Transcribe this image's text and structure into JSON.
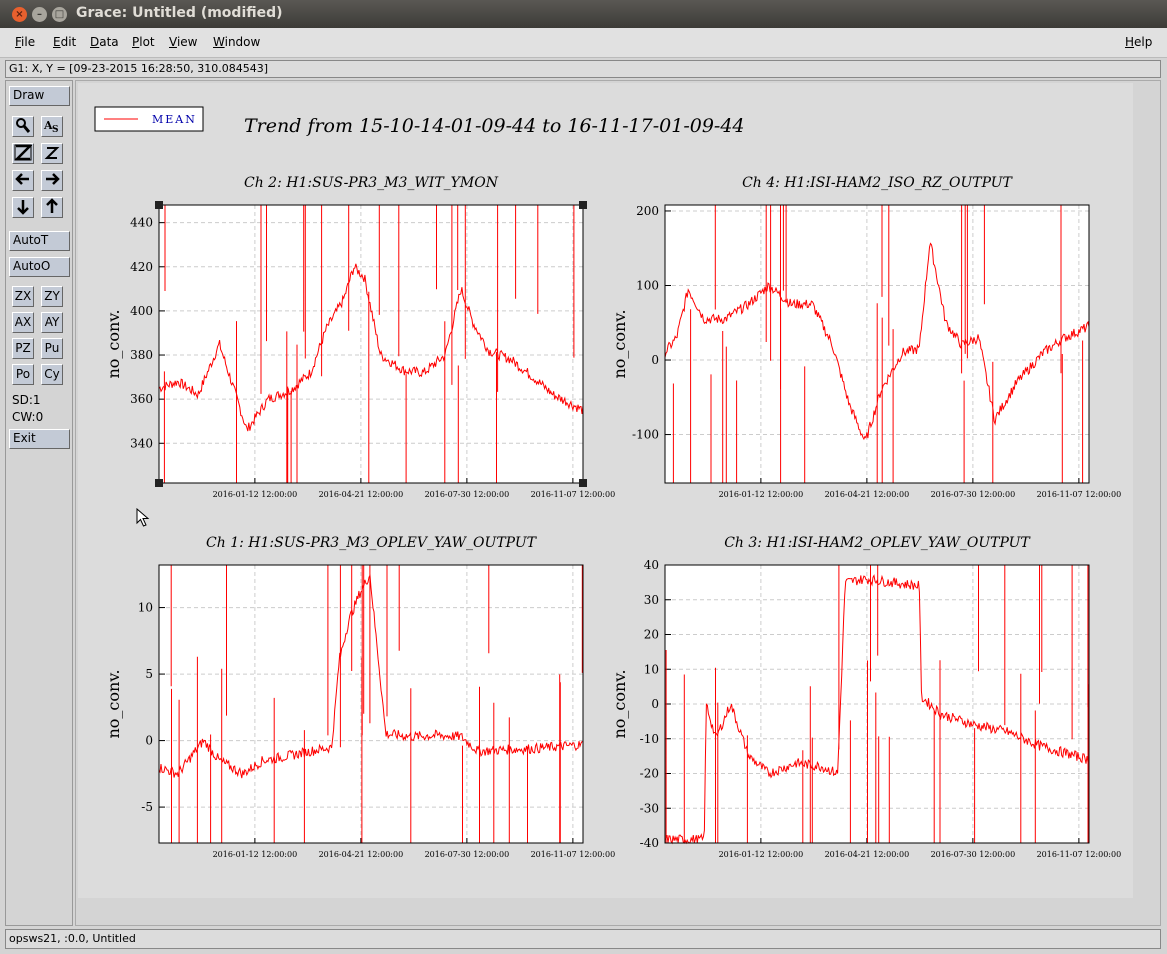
{
  "window": {
    "title": "Grace: Untitled (modified)",
    "close_glyph": "×",
    "min_glyph": "–",
    "max_glyph": "□"
  },
  "menu": {
    "file": "File",
    "edit": "Edit",
    "data": "Data",
    "plot": "Plot",
    "view": "View",
    "window": "Window",
    "help": "Help"
  },
  "locator": "G1: X, Y = [09-23-2015 16:28:50, 310.084543]",
  "toolbar": {
    "draw": "Draw",
    "autot": "AutoT",
    "autoo": "AutoO",
    "exit": "Exit",
    "zx": "ZX",
    "zy": "ZY",
    "ax": "AX",
    "ay": "AY",
    "pz": "PZ",
    "pu": "Pu",
    "po": "Po",
    "cy": "Cy",
    "sd": "SD:1",
    "cw": "CW:0",
    "icons": [
      "zoom-icon",
      "text-icon",
      "autoscale-z-icon",
      "zoom-out-icon",
      "left-arrow-icon",
      "right-arrow-icon",
      "down-arrow-icon",
      "up-arrow-icon"
    ]
  },
  "status": "opsws21, :0.0, Untitled",
  "legend": {
    "label": "MEAN"
  },
  "figure_title": "Trend from 15-10-14-01-09-44 to 16-11-17-01-09-44",
  "colors": {
    "series": "#ff0000",
    "plot_bg": "#ffffff",
    "canvas_bg": "#dcdcdc"
  },
  "chart_data": [
    {
      "type": "line",
      "title": "Ch 2: H1:SUS-PR3_M3_WIT_YMON",
      "ylabel": "no_conv.",
      "xlabel": "",
      "x_ticks": [
        "2016-01-12 12:00:00",
        "2016-04-21 12:00:00",
        "2016-07-30 12:00:00",
        "2016-11-07 12:00:00"
      ],
      "y_ticks": [
        "340",
        "360",
        "380",
        "400",
        "420",
        "440"
      ],
      "ylim": [
        322,
        448
      ],
      "series": [
        {
          "name": "MEAN",
          "x": [
            "2015-10-14",
            "2015-11-01",
            "2015-11-20",
            "2015-12-10",
            "2016-01-05",
            "2016-01-25",
            "2016-02-15",
            "2016-03-05",
            "2016-03-20",
            "2016-04-05",
            "2016-04-15",
            "2016-04-25",
            "2016-05-10",
            "2016-06-01",
            "2016-06-20",
            "2016-07-10",
            "2016-07-25",
            "2016-08-05",
            "2016-08-20",
            "2016-09-10",
            "2016-10-01",
            "2016-10-20",
            "2016-11-17"
          ],
          "values": [
            365,
            368,
            362,
            385,
            346,
            360,
            364,
            372,
            392,
            405,
            420,
            415,
            380,
            373,
            372,
            380,
            410,
            395,
            382,
            378,
            370,
            362,
            355
          ]
        }
      ]
    },
    {
      "type": "line",
      "title": "Ch 4: H1:ISI-HAM2_ISO_RZ_OUTPUT",
      "ylabel": "no_conv.",
      "xlabel": "",
      "x_ticks": [
        "2016-01-12 12:00:00",
        "2016-04-21 12:00:00",
        "2016-07-30 12:00:00",
        "2016-11-07 12:00:00"
      ],
      "y_ticks": [
        "-100",
        "0",
        "100",
        "200"
      ],
      "ylim": [
        -165,
        208
      ],
      "series": [
        {
          "name": "MEAN",
          "x": [
            "2015-10-14",
            "2015-10-25",
            "2015-11-05",
            "2015-11-20",
            "2015-12-10",
            "2016-01-01",
            "2016-01-20",
            "2016-02-10",
            "2016-03-01",
            "2016-03-20",
            "2016-04-05",
            "2016-04-20",
            "2016-05-05",
            "2016-05-25",
            "2016-06-10",
            "2016-06-20",
            "2016-07-05",
            "2016-07-20",
            "2016-08-05",
            "2016-08-20",
            "2016-09-10",
            "2016-10-05",
            "2016-10-25",
            "2016-11-17"
          ],
          "values": [
            10,
            30,
            95,
            55,
            55,
            75,
            100,
            75,
            75,
            20,
            -60,
            -110,
            -40,
            10,
            15,
            160,
            50,
            20,
            30,
            -80,
            -30,
            10,
            30,
            45
          ]
        }
      ]
    },
    {
      "type": "line",
      "title": "Ch 1: H1:SUS-PR3_M3_OPLEV_YAW_OUTPUT",
      "ylabel": "no_conv.",
      "xlabel": "",
      "x_ticks": [
        "2016-01-12 12:00:00",
        "2016-04-21 12:00:00",
        "2016-07-30 12:00:00",
        "2016-11-07 12:00:00"
      ],
      "y_ticks": [
        "-5",
        "0",
        "5",
        "10"
      ],
      "ylim": [
        -7.7,
        13.2
      ],
      "series": [
        {
          "name": "MEAN",
          "x": [
            "2015-10-14",
            "2015-11-01",
            "2015-11-25",
            "2015-12-10",
            "2016-01-01",
            "2016-01-20",
            "2016-02-10",
            "2016-03-05",
            "2016-03-25",
            "2016-04-01",
            "2016-04-10",
            "2016-04-20",
            "2016-04-30",
            "2016-05-15",
            "2016-06-10",
            "2016-07-01",
            "2016-07-25",
            "2016-08-10",
            "2016-09-01",
            "2016-10-01",
            "2016-11-17"
          ],
          "values": [
            -2,
            -2.5,
            0,
            -1.5,
            -2.5,
            -1.5,
            -1.2,
            -0.8,
            -0.5,
            6,
            9,
            11,
            12.5,
            0.5,
            0.3,
            0.4,
            0.3,
            -0.8,
            -0.7,
            -0.6,
            -0.3
          ]
        }
      ]
    },
    {
      "type": "line",
      "title": "Ch 3: H1:ISI-HAM2_OPLEV_YAW_OUTPUT",
      "ylabel": "no_conv.",
      "xlabel": "",
      "x_ticks": [
        "2016-01-12 12:00:00",
        "2016-04-21 12:00:00",
        "2016-07-30 12:00:00",
        "2016-11-07 12:00:00"
      ],
      "y_ticks": [
        "-40",
        "-30",
        "-20",
        "10",
        "0",
        "-10",
        "20",
        "30",
        "40"
      ],
      "ylim": [
        -40,
        40
      ],
      "series": [
        {
          "name": "MEAN",
          "x": [
            "2015-10-14",
            "2015-11-20",
            "2015-11-22",
            "2015-12-01",
            "2015-12-15",
            "2016-01-01",
            "2016-01-20",
            "2016-02-15",
            "2016-03-10",
            "2016-03-25",
            "2016-04-01",
            "2016-04-20",
            "2016-05-15",
            "2016-06-10",
            "2016-06-12",
            "2016-07-01",
            "2016-08-01",
            "2016-09-01",
            "2016-10-01",
            "2016-11-17"
          ],
          "values": [
            -39,
            -39,
            0,
            -10,
            0,
            -15,
            -20,
            -17,
            -18,
            -20,
            35,
            36,
            35,
            34,
            2,
            -3,
            -6,
            -8,
            -12,
            -16
          ]
        }
      ]
    }
  ]
}
